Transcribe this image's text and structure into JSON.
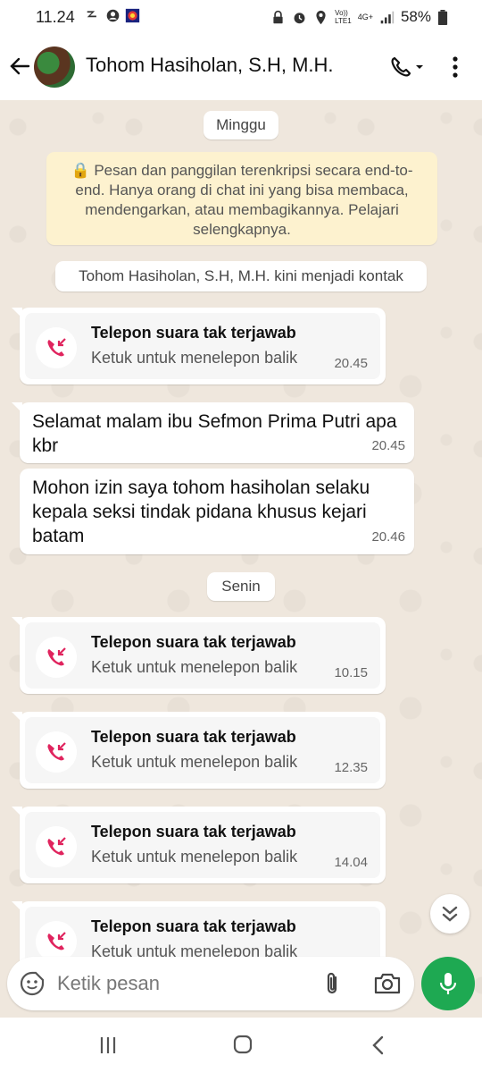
{
  "status_bar": {
    "time": "11.24",
    "battery": "58%",
    "network_top": "Vo))",
    "network_bottom": "LTE1",
    "gen": "4G+"
  },
  "header": {
    "contact_name": "Tohom Hasiholan, S.H, M.H."
  },
  "chat": {
    "day1": "Minggu",
    "encryption_notice": "🔒 Pesan dan panggilan terenkripsi secara end-to-end. Hanya orang di chat ini yang bisa membaca, mendengarkan, atau membagikannya. Pelajari selengkapnya.",
    "contact_notice": "Tohom Hasiholan, S.H, M.H. kini menjadi kontak",
    "day2": "Senin",
    "missed_call_title": "Telepon suara tak terjawab",
    "missed_call_sub": "Ketuk untuk menelepon balik",
    "calls": [
      {
        "time": "20.45"
      },
      {
        "time": "10.15"
      },
      {
        "time": "12.35"
      },
      {
        "time": "14.04"
      },
      {
        "time": ""
      }
    ],
    "messages": [
      {
        "text": "Selamat malam ibu Sefmon Prima Putri apa kbr",
        "time": "20.45"
      },
      {
        "text": "Mohon izin saya tohom hasiholan selaku kepala seksi tindak pidana khusus kejari batam",
        "time": "20.46"
      }
    ]
  },
  "input": {
    "placeholder": "Ketik pesan"
  },
  "colors": {
    "accent_green": "#1ea952",
    "chat_bg": "#efe7dd",
    "notice_bg": "#fdf2cf",
    "missed_red": "#e0245e"
  }
}
